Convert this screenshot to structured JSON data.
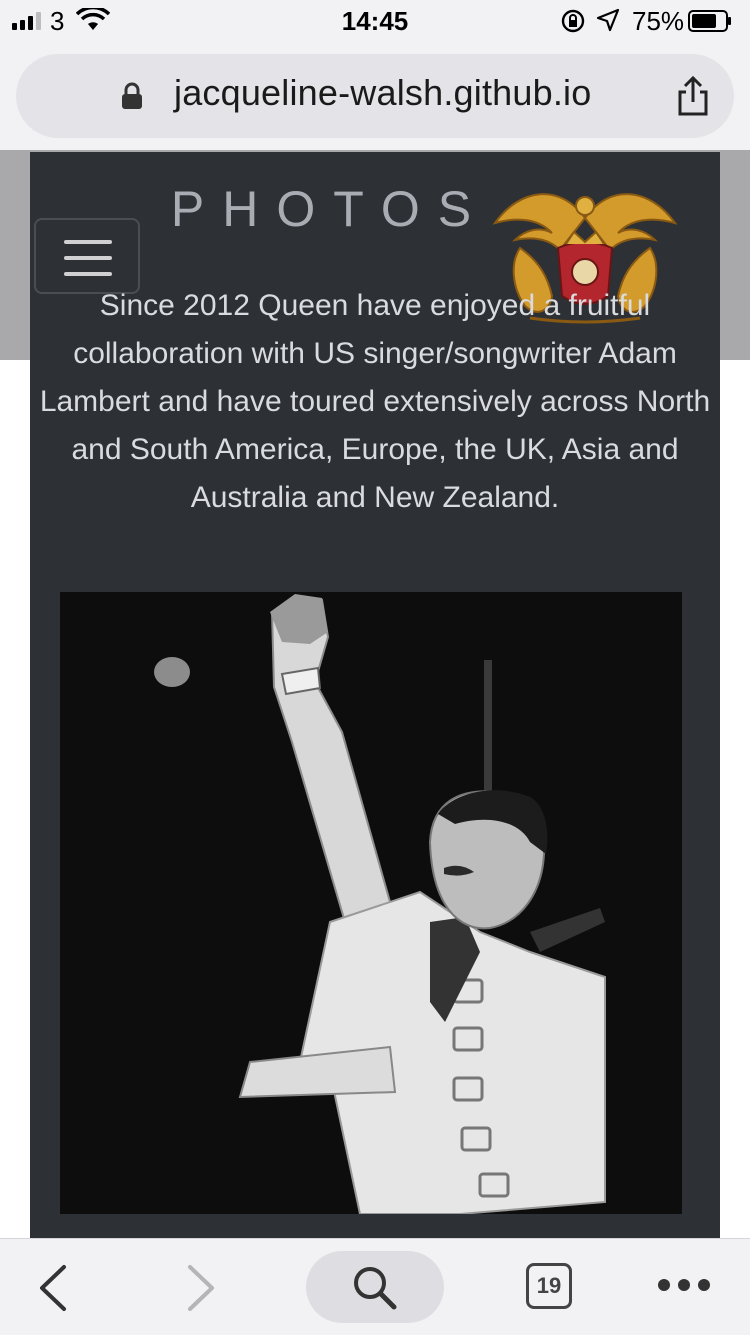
{
  "status_bar": {
    "carrier": "3",
    "time": "14:45",
    "battery_percent": "75%",
    "battery_level": 0.75
  },
  "browser": {
    "url": "jacqueline-walsh.github.io",
    "tab_count": "19"
  },
  "page": {
    "section_title": "PHOTOS",
    "intro_text": "Since 2012 Queen have enjoyed a fruitful collaboration with US singer/songwriter Adam Lambert and have toured extensively across North and South America, Europe, the UK, Asia and Australia and New Zealand."
  },
  "colors": {
    "content_bg": "#2d3035",
    "title_text": "#a9adb3",
    "body_text": "#d9dbde",
    "crest_gold": "#d39a2c",
    "crest_red": "#b3262d"
  },
  "icons": {
    "status": [
      "signal-icon",
      "wifi-icon",
      "orientation-lock-icon",
      "location-arrow-icon",
      "battery-icon"
    ],
    "browser": [
      "padlock-icon",
      "share-icon"
    ],
    "toolbar": [
      "back-chevron-icon",
      "forward-chevron-icon",
      "search-icon",
      "tabs-icon",
      "more-icon"
    ]
  }
}
